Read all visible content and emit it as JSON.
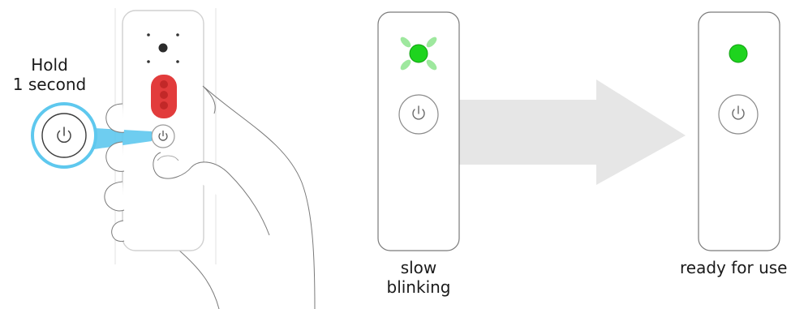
{
  "instruction": {
    "line1": "Hold",
    "line2": "1 second"
  },
  "states": [
    {
      "label_line1": "slow",
      "label_line2": "blinking",
      "led_color": "#1ed41e",
      "led_mode": "blinking"
    },
    {
      "label": "ready for use",
      "led_color": "#1ed41e",
      "led_mode": "steady"
    }
  ],
  "colors": {
    "device_body": "#ffffff",
    "device_outline": "#9a9a9a",
    "red_panel": "#e23c3c",
    "highlight_ring": "#5ec8ee",
    "arrow": "#e6e6e6",
    "led_glow": "#9ee89e"
  },
  "icons": [
    "power-icon",
    "hand-outline",
    "arrow-right"
  ]
}
